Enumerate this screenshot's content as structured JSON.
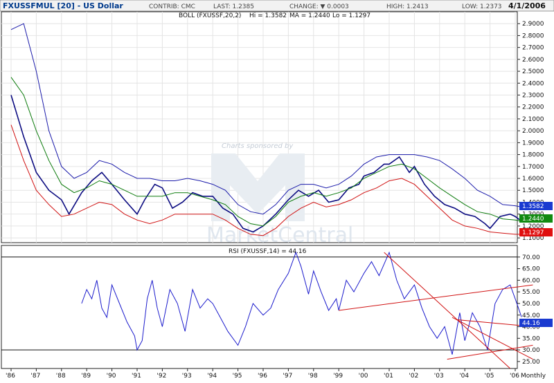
{
  "header": {
    "symbol": "FXUSSFMUL [20] - US Dollar",
    "contrib": "CONTRIB: CMC",
    "last": "LAST: 1.2385",
    "change": "CHANGE: ▼ 0.0003",
    "high": "HIGH: 1.2413",
    "low": "LOW: 1.2373",
    "date": "4/1/2006"
  },
  "price_legend": {
    "prefix": "BOLL (FXUSSF,20,2)",
    "hi": "Hi = 1.3582",
    "ma": "MA = 1.2440",
    "lo": "Lo = 1.1297"
  },
  "rsi_legend": "RSI (FXUSSF,14) = 44.16",
  "watermark": {
    "sponsor": "Charts sponsored by",
    "brand": "MarketCentral"
  },
  "frequency_label": "Monthly",
  "colors": {
    "price": "#0a0a80",
    "upper_band": "#1a1aaa",
    "middle_band": "#0a7a0a",
    "lower_band": "#d01010",
    "rsi": "#1a1acc",
    "trendline": "#d01010",
    "hi_badge": "#1a3ad0",
    "ma_badge": "#118a11",
    "lo_badge": "#e01010",
    "rsi_badge": "#1a3ad0"
  },
  "chart_data": [
    {
      "type": "line",
      "title": "FXUSSFMUL [20] - US Dollar",
      "x_ticks": [
        "'86",
        "'87",
        "'88",
        "'89",
        "'90",
        "'91",
        "'92",
        "'93",
        "'94",
        "'95",
        "'96",
        "'97",
        "'98",
        "'99",
        "'00",
        "'01",
        "'02",
        "'03",
        "'04",
        "'05",
        "'06"
      ],
      "y_ticks": [
        "2.9000",
        "2.8000",
        "2.7000",
        "2.6000",
        "2.5000",
        "2.4000",
        "2.3000",
        "2.2000",
        "2.1000",
        "2.0000",
        "1.9000",
        "1.8000",
        "1.7000",
        "1.6000",
        "1.5000",
        "1.4000",
        "1.3000",
        "1.2000",
        "1.1000"
      ],
      "ylim": [
        1.06,
        3.0
      ],
      "grid": true,
      "series": [
        {
          "name": "Price",
          "x": [
            1986.0,
            1986.5,
            1987.0,
            1987.5,
            1988.0,
            1988.3,
            1988.8,
            1989.2,
            1989.6,
            1990.0,
            1990.5,
            1991.0,
            1991.3,
            1991.7,
            1992.0,
            1992.4,
            1992.8,
            1993.2,
            1993.6,
            1994.0,
            1994.4,
            1994.8,
            1995.2,
            1995.6,
            1996.0,
            1996.5,
            1997.0,
            1997.4,
            1997.8,
            1998.2,
            1998.6,
            1999.0,
            1999.4,
            1999.8,
            2000.0,
            2000.4,
            2000.8,
            2001.0,
            2001.4,
            2001.8,
            2002.0,
            2002.4,
            2002.8,
            2003.2,
            2003.6,
            2004.0,
            2004.4,
            2004.8,
            2005.0,
            2005.4,
            2005.8,
            2006.0,
            2006.25
          ],
          "values": [
            2.3,
            1.95,
            1.65,
            1.5,
            1.42,
            1.3,
            1.48,
            1.58,
            1.65,
            1.55,
            1.42,
            1.3,
            1.42,
            1.55,
            1.52,
            1.35,
            1.4,
            1.48,
            1.45,
            1.45,
            1.35,
            1.3,
            1.18,
            1.15,
            1.2,
            1.3,
            1.42,
            1.5,
            1.45,
            1.5,
            1.4,
            1.42,
            1.52,
            1.55,
            1.62,
            1.65,
            1.72,
            1.72,
            1.78,
            1.65,
            1.7,
            1.55,
            1.45,
            1.38,
            1.35,
            1.3,
            1.28,
            1.22,
            1.18,
            1.28,
            1.3,
            1.28,
            1.24
          ]
        },
        {
          "name": "Hi",
          "x": [
            1986.0,
            1986.5,
            1987.0,
            1987.5,
            1988.0,
            1988.5,
            1989.0,
            1989.5,
            1990.0,
            1990.5,
            1991.0,
            1991.5,
            1992.0,
            1992.5,
            1993.0,
            1993.5,
            1994.0,
            1994.5,
            1995.0,
            1995.5,
            1996.0,
            1996.5,
            1997.0,
            1997.5,
            1998.0,
            1998.5,
            1999.0,
            1999.5,
            2000.0,
            2000.5,
            2001.0,
            2001.5,
            2002.0,
            2002.5,
            2003.0,
            2003.5,
            2004.0,
            2004.5,
            2005.0,
            2005.5,
            2006.0,
            2006.25
          ],
          "values": [
            2.85,
            2.9,
            2.5,
            2.0,
            1.7,
            1.6,
            1.65,
            1.75,
            1.72,
            1.65,
            1.6,
            1.6,
            1.58,
            1.58,
            1.6,
            1.58,
            1.55,
            1.5,
            1.38,
            1.32,
            1.3,
            1.38,
            1.5,
            1.55,
            1.55,
            1.52,
            1.55,
            1.62,
            1.72,
            1.78,
            1.8,
            1.8,
            1.8,
            1.78,
            1.75,
            1.68,
            1.6,
            1.5,
            1.45,
            1.38,
            1.37,
            1.36
          ]
        },
        {
          "name": "MA",
          "x": [
            1986.0,
            1986.5,
            1987.0,
            1987.5,
            1988.0,
            1988.5,
            1989.0,
            1989.5,
            1990.0,
            1990.5,
            1991.0,
            1991.5,
            1992.0,
            1992.5,
            1993.0,
            1993.5,
            1994.0,
            1994.5,
            1995.0,
            1995.5,
            1996.0,
            1996.5,
            1997.0,
            1997.5,
            1998.0,
            1998.5,
            1999.0,
            1999.5,
            2000.0,
            2000.5,
            2001.0,
            2001.5,
            2002.0,
            2002.5,
            2003.0,
            2003.5,
            2004.0,
            2004.5,
            2005.0,
            2005.5,
            2006.0,
            2006.25
          ],
          "values": [
            2.45,
            2.3,
            2.0,
            1.75,
            1.55,
            1.48,
            1.52,
            1.58,
            1.55,
            1.5,
            1.45,
            1.45,
            1.45,
            1.48,
            1.48,
            1.45,
            1.42,
            1.38,
            1.28,
            1.22,
            1.2,
            1.28,
            1.4,
            1.45,
            1.48,
            1.45,
            1.48,
            1.52,
            1.6,
            1.65,
            1.7,
            1.72,
            1.68,
            1.6,
            1.52,
            1.45,
            1.38,
            1.32,
            1.3,
            1.26,
            1.25,
            1.24
          ]
        },
        {
          "name": "Lo",
          "x": [
            1986.0,
            1986.5,
            1987.0,
            1987.5,
            1988.0,
            1988.5,
            1989.0,
            1989.5,
            1990.0,
            1990.5,
            1991.0,
            1991.5,
            1992.0,
            1992.5,
            1993.0,
            1993.5,
            1994.0,
            1994.5,
            1995.0,
            1995.5,
            1996.0,
            1996.5,
            1997.0,
            1997.5,
            1998.0,
            1998.5,
            1999.0,
            1999.5,
            2000.0,
            2000.5,
            2001.0,
            2001.5,
            2002.0,
            2002.5,
            2003.0,
            2003.5,
            2004.0,
            2004.5,
            2005.0,
            2005.5,
            2006.0,
            2006.25
          ],
          "values": [
            2.05,
            1.75,
            1.5,
            1.38,
            1.28,
            1.3,
            1.35,
            1.4,
            1.38,
            1.3,
            1.25,
            1.22,
            1.25,
            1.3,
            1.3,
            1.3,
            1.3,
            1.25,
            1.18,
            1.13,
            1.12,
            1.18,
            1.28,
            1.35,
            1.4,
            1.36,
            1.38,
            1.42,
            1.48,
            1.52,
            1.58,
            1.6,
            1.55,
            1.45,
            1.35,
            1.25,
            1.2,
            1.18,
            1.15,
            1.14,
            1.13,
            1.13
          ]
        }
      ],
      "badges": {
        "hi": "1.3582",
        "ma": "1.2440",
        "lo": "1.1297"
      }
    },
    {
      "type": "line",
      "title": "RSI (FXUSSF,14) = 44.16",
      "x_ticks": [
        "'86",
        "'87",
        "'88",
        "'89",
        "'90",
        "'91",
        "'92",
        "'93",
        "'94",
        "'95",
        "'96",
        "'97",
        "'98",
        "'99",
        "'00",
        "'01",
        "'02",
        "'03",
        "'04",
        "'05",
        "'06"
      ],
      "y_ticks": [
        "70.00",
        "65.00",
        "60.00",
        "55.00",
        "50.00",
        "45.00",
        "40.00",
        "35.00",
        "30.00",
        "25.00"
      ],
      "ylim": [
        22,
        75
      ],
      "reference_lines": [
        70,
        30
      ],
      "series": [
        {
          "name": "RSI",
          "x": [
            1988.8,
            1989.0,
            1989.2,
            1989.4,
            1989.6,
            1989.8,
            1990.0,
            1990.3,
            1990.6,
            1990.9,
            1991.0,
            1991.2,
            1991.4,
            1991.6,
            1991.8,
            1992.0,
            1992.3,
            1992.6,
            1992.9,
            1993.2,
            1993.5,
            1993.8,
            1994.0,
            1994.3,
            1994.6,
            1995.0,
            1995.3,
            1995.6,
            1996.0,
            1996.3,
            1996.6,
            1997.0,
            1997.3,
            1997.5,
            1997.8,
            1998.0,
            1998.3,
            1998.6,
            1998.9,
            1999.0,
            1999.3,
            1999.6,
            2000.0,
            2000.3,
            2000.6,
            2001.0,
            2001.3,
            2001.6,
            2002.0,
            2002.3,
            2002.6,
            2002.9,
            2003.2,
            2003.5,
            2003.8,
            2004.0,
            2004.3,
            2004.6,
            2004.9,
            2005.2,
            2005.5,
            2005.8,
            2006.0,
            2006.25
          ],
          "values": [
            50,
            56,
            52,
            60,
            48,
            44,
            58,
            50,
            42,
            36,
            30,
            34,
            52,
            60,
            48,
            40,
            56,
            50,
            38,
            56,
            48,
            52,
            50,
            44,
            38,
            32,
            40,
            50,
            45,
            48,
            56,
            63,
            72,
            66,
            54,
            64,
            55,
            47,
            52,
            47,
            60,
            55,
            63,
            68,
            62,
            72,
            60,
            52,
            58,
            48,
            40,
            35,
            40,
            28,
            46,
            34,
            46,
            40,
            30,
            50,
            56,
            58,
            52,
            44.16
          ]
        },
        {
          "name": "trend-1",
          "x": [
            1999.0,
            2006.7
          ],
          "values": [
            47,
            58
          ]
        },
        {
          "name": "trend-2",
          "x": [
            2000.8,
            2005.8
          ],
          "values": [
            72,
            22
          ]
        },
        {
          "name": "trend-3",
          "x": [
            2003.7,
            2006.7
          ],
          "values": [
            43,
            40
          ]
        },
        {
          "name": "trend-4",
          "x": [
            2003.3,
            2006.7
          ],
          "values": [
            26,
            32
          ]
        },
        {
          "name": "trend-5",
          "x": [
            2003.5,
            2006.7
          ],
          "values": [
            44,
            26
          ]
        }
      ],
      "badge": "44.16"
    }
  ]
}
